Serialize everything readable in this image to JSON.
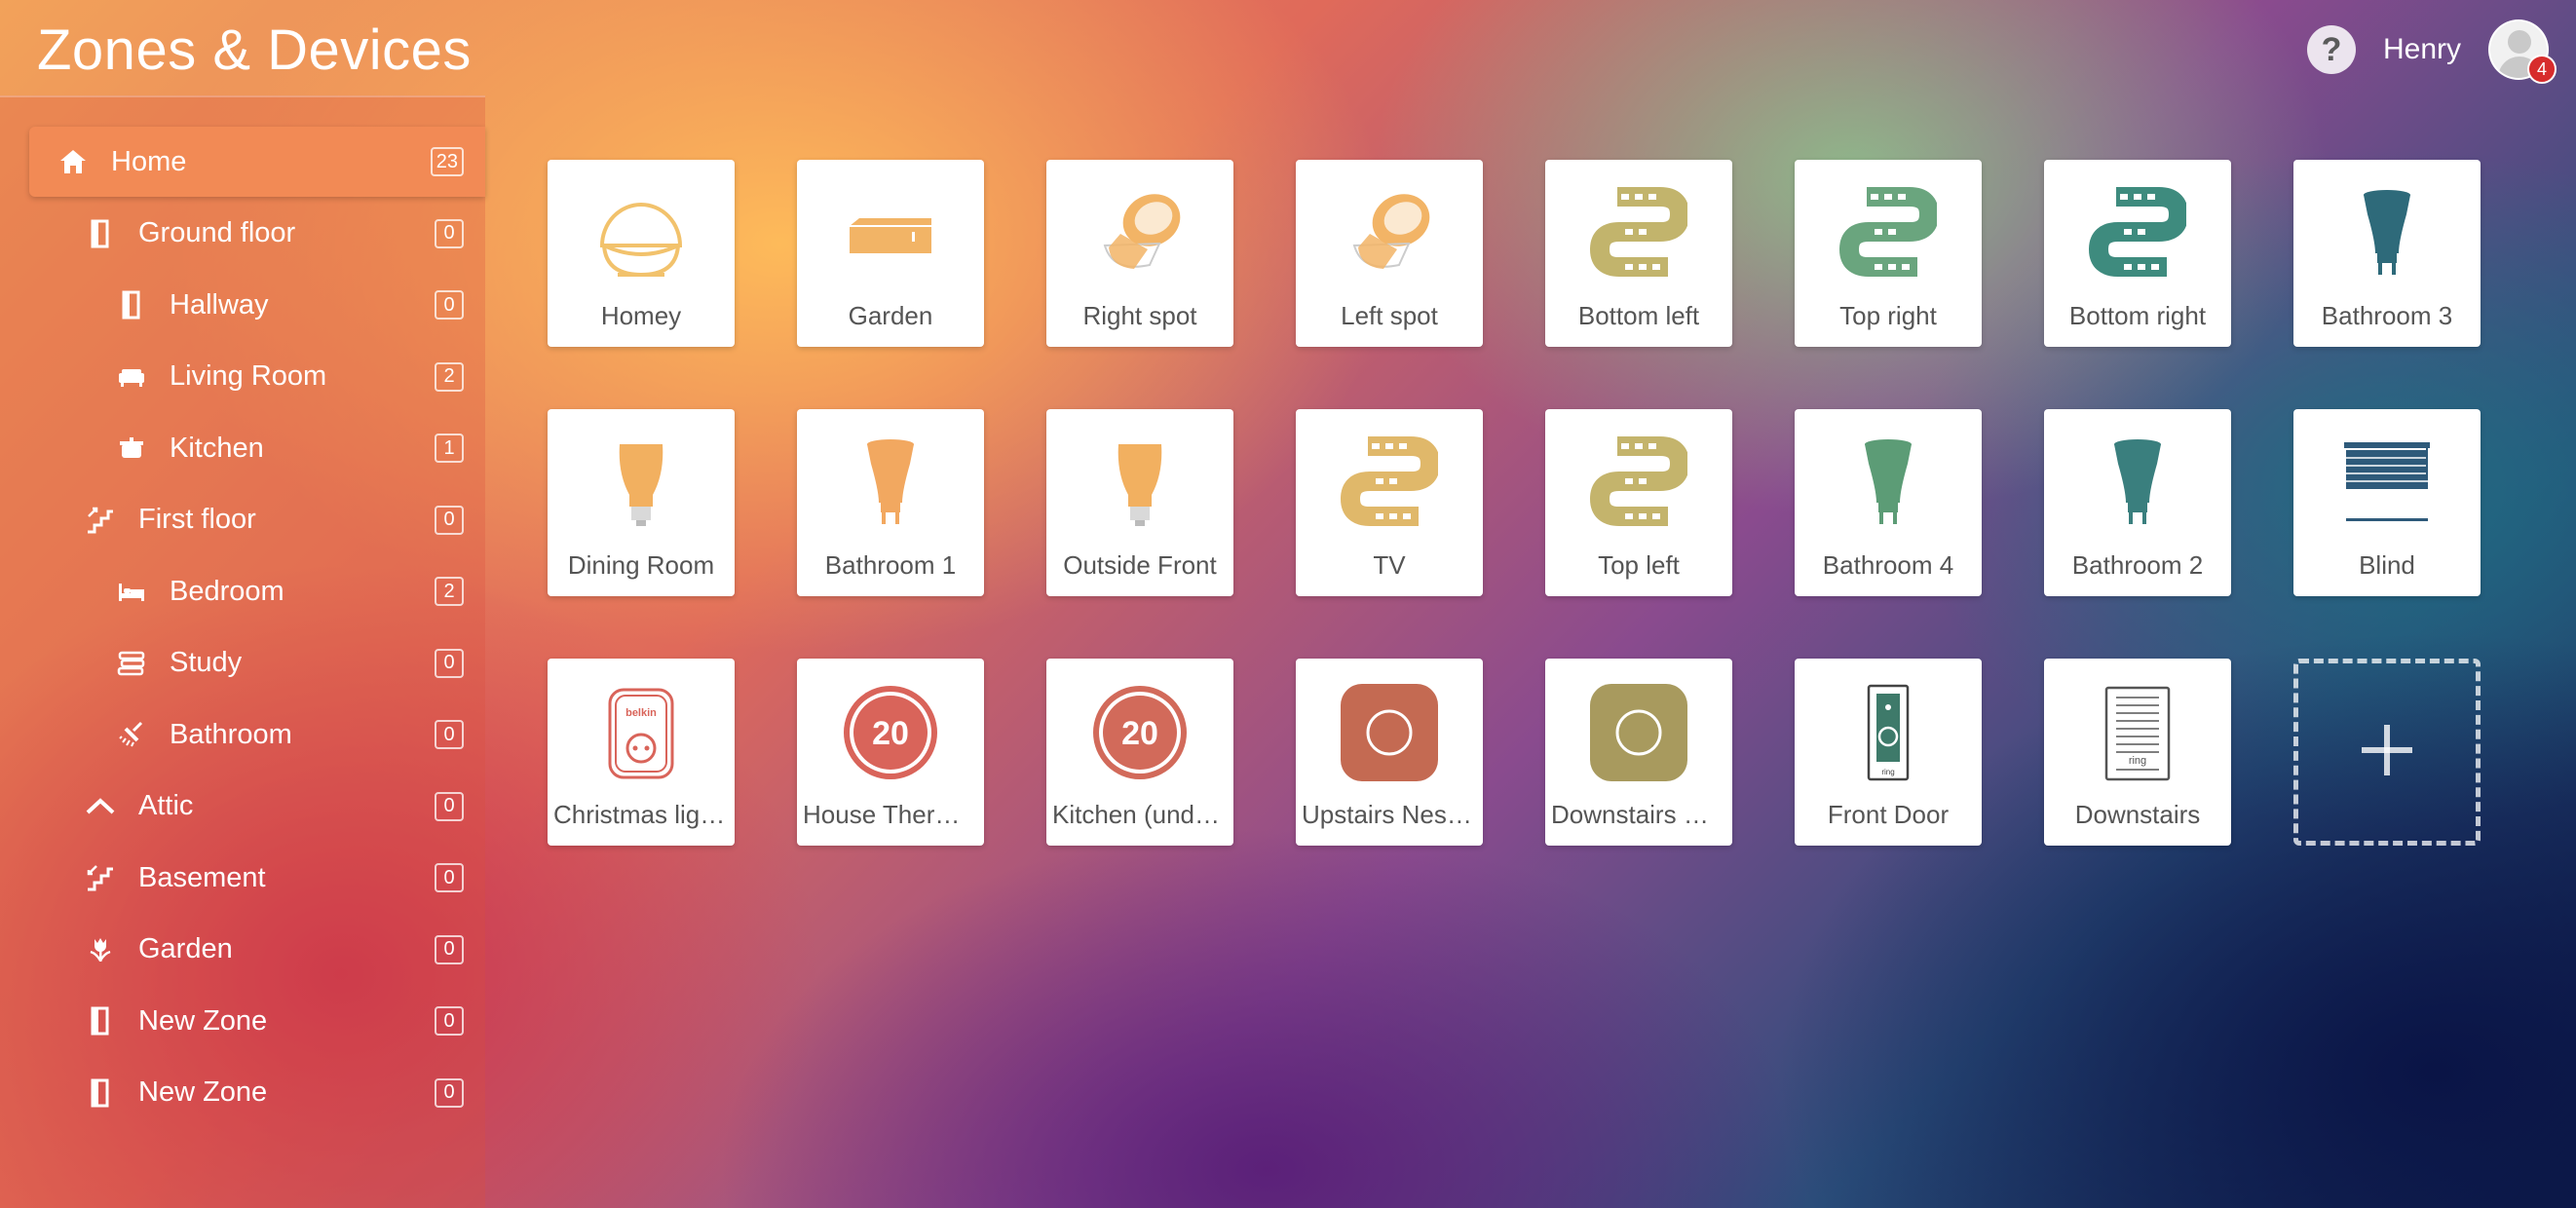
{
  "app": {
    "title": "Zones & Devices"
  },
  "header": {
    "help_label": "?",
    "user_name": "Henry",
    "notification_count": "4"
  },
  "sidebar": {
    "zones": [
      {
        "label": "Home",
        "count": "23",
        "icon": "home-icon",
        "level": 0,
        "active": true
      },
      {
        "label": "Ground floor",
        "count": "0",
        "icon": "door-icon",
        "level": 1
      },
      {
        "label": "Hallway",
        "count": "0",
        "icon": "door-icon",
        "level": 2
      },
      {
        "label": "Living Room",
        "count": "2",
        "icon": "sofa-icon",
        "level": 2
      },
      {
        "label": "Kitchen",
        "count": "1",
        "icon": "pot-icon",
        "level": 2
      },
      {
        "label": "First floor",
        "count": "0",
        "icon": "stairs-up-icon",
        "level": 1
      },
      {
        "label": "Bedroom",
        "count": "2",
        "icon": "bed-icon",
        "level": 2
      },
      {
        "label": "Study",
        "count": "0",
        "icon": "books-icon",
        "level": 2
      },
      {
        "label": "Bathroom",
        "count": "0",
        "icon": "shower-icon",
        "level": 2
      },
      {
        "label": "Attic",
        "count": "0",
        "icon": "roof-icon",
        "level": 1
      },
      {
        "label": "Basement",
        "count": "0",
        "icon": "stairs-down-icon",
        "level": 1
      },
      {
        "label": "Garden",
        "count": "0",
        "icon": "tulip-icon",
        "level": 1
      },
      {
        "label": "New Zone",
        "count": "0",
        "icon": "door-icon",
        "level": 1
      },
      {
        "label": "New Zone",
        "count": "0",
        "icon": "door-icon",
        "level": 1
      }
    ]
  },
  "devices": [
    {
      "name": "Homey",
      "icon": "homey-icon",
      "color": "#f2c26c"
    },
    {
      "name": "Garden",
      "icon": "speaker-icon",
      "color": "#f2b466"
    },
    {
      "name": "Right spot",
      "icon": "spot-lamp-icon",
      "color": "#f2b466"
    },
    {
      "name": "Left spot",
      "icon": "spot-lamp-icon",
      "color": "#f2b466"
    },
    {
      "name": "Bottom left",
      "icon": "light-strip-icon",
      "color": "#c2b46c"
    },
    {
      "name": "Top right",
      "icon": "light-strip-icon",
      "color": "#6aa57e"
    },
    {
      "name": "Bottom right",
      "icon": "light-strip-icon",
      "color": "#3e8b7e"
    },
    {
      "name": "Bathroom 3",
      "icon": "gu10-bulb-icon",
      "color": "#2e6a7a"
    },
    {
      "name": "Dining Room",
      "icon": "bulb-icon",
      "color": "#f2b060"
    },
    {
      "name": "Bathroom 1",
      "icon": "gu10-bulb-icon",
      "color": "#f2a860"
    },
    {
      "name": "Outside Front",
      "icon": "bulb-icon",
      "color": "#f2b060"
    },
    {
      "name": "TV",
      "icon": "light-strip-icon",
      "color": "#e0b86a"
    },
    {
      "name": "Top left",
      "icon": "light-strip-icon",
      "color": "#c4b46c"
    },
    {
      "name": "Bathroom 4",
      "icon": "gu10-bulb-icon",
      "color": "#5c9c76"
    },
    {
      "name": "Bathroom 2",
      "icon": "gu10-bulb-icon",
      "color": "#3a7f7e"
    },
    {
      "name": "Blind",
      "icon": "blind-icon",
      "color": "#2e5a7a"
    },
    {
      "name": "Christmas lights",
      "icon": "smart-plug-icon",
      "color": "#d9645a",
      "icon_text": "belkin"
    },
    {
      "name": "House Thermostat",
      "icon": "thermostat-icon",
      "color": "#d9645a",
      "icon_text": "20"
    },
    {
      "name": "Kitchen (underfloor)",
      "icon": "thermostat-icon",
      "color": "#d26a5a",
      "icon_text": "20"
    },
    {
      "name": "Upstairs Nest Protect",
      "icon": "smoke-detector-icon",
      "color": "#c46a52"
    },
    {
      "name": "Downstairs Nest Protect",
      "icon": "smoke-detector-icon",
      "color": "#a89a5e"
    },
    {
      "name": "Front Door",
      "icon": "doorbell-icon",
      "color": "#3e7a6a"
    },
    {
      "name": "Downstairs",
      "icon": "chime-icon",
      "color": "#555555",
      "icon_text": "ring"
    }
  ],
  "add_device": {
    "icon": "plus-icon"
  }
}
